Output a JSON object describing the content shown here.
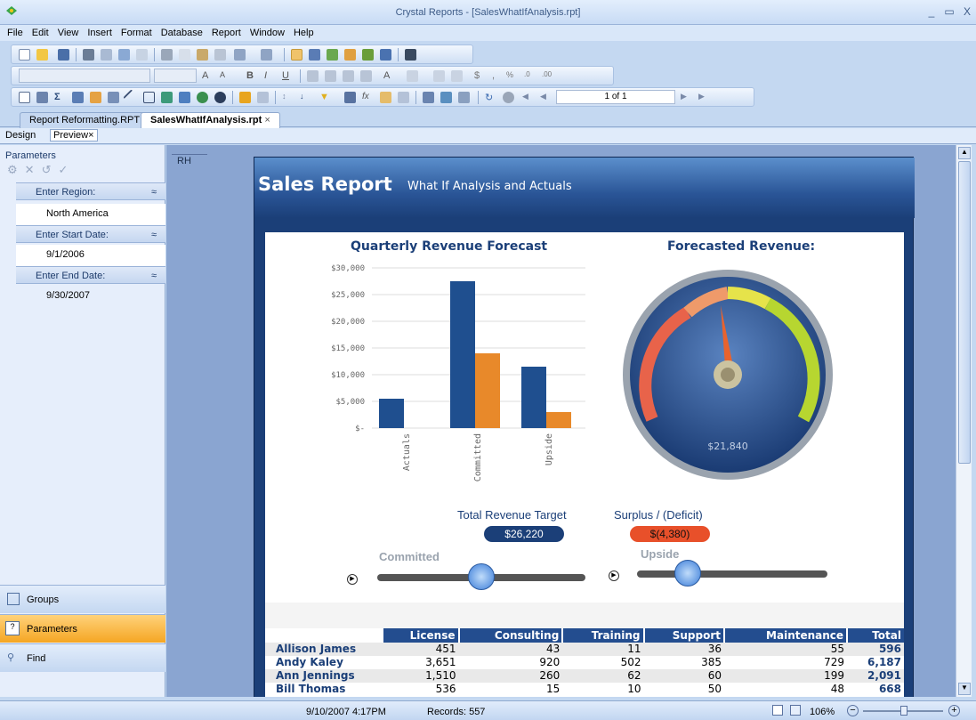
{
  "window": {
    "title": "Crystal Reports - [SalesWhatIfAnalysis.rpt]",
    "min": "_",
    "max": "▭",
    "close": "X"
  },
  "menu": [
    "File",
    "Edit",
    "View",
    "Insert",
    "Format",
    "Database",
    "Report",
    "Window",
    "Help"
  ],
  "toolbar": {
    "page_indicator": "1 of 1"
  },
  "tabs": [
    {
      "label": "Report Reformatting.RPT"
    },
    {
      "label": "SalesWhatIfAnalysis.rpt",
      "close": "×"
    }
  ],
  "view_tabs": {
    "design": "Design",
    "preview": "Preview",
    "close": "×"
  },
  "left": {
    "title": "Parameters",
    "params": [
      {
        "label": "Enter Region:",
        "value": "North America"
      },
      {
        "label": "Enter Start Date:",
        "value": "9/1/2006"
      },
      {
        "label": "Enter End Date:",
        "value": "9/30/2007"
      }
    ],
    "nav": [
      "Groups",
      "Parameters",
      "Find"
    ]
  },
  "report": {
    "section": "RH",
    "title": "Sales Report",
    "subtitle": "What If Analysis and Actuals",
    "chart_title": "Quarterly Revenue Forecast",
    "gauge_title": "Forecasted Revenue:",
    "gauge_value": "$21,840",
    "target_label": "Total Revenue Target",
    "target_value": "$26,220",
    "surplus_label": "Surplus / (Deficit)",
    "surplus_value": "$(4,380)",
    "slider1": "Committed",
    "slider2": "Upside"
  },
  "chart_data": {
    "type": "bar",
    "title": "Quarterly Revenue Forecast",
    "categories": [
      "Actuals",
      "Committed",
      "Upside"
    ],
    "series": [
      {
        "values": [
          5500,
          27500,
          11500
        ],
        "color": "#1f4f8f"
      },
      {
        "values": [
          0,
          14000,
          3000
        ],
        "color": "#e8892a"
      }
    ],
    "yticks": [
      "$30,000",
      "$25,000",
      "$20,000",
      "$15,000",
      "$10,000",
      "$5,000",
      "$-"
    ],
    "ylim": [
      0,
      30000
    ]
  },
  "table": {
    "headers": [
      "License",
      "Consulting",
      "Training",
      "Support",
      "Maintenance",
      "Total"
    ],
    "rows": [
      {
        "name": "Allison James",
        "vals": [
          "451",
          "43",
          "11",
          "36",
          "55",
          "596"
        ]
      },
      {
        "name": "Andy Kaley",
        "vals": [
          "3,651",
          "920",
          "502",
          "385",
          "729",
          "6,187"
        ]
      },
      {
        "name": "Ann Jennings",
        "vals": [
          "1,510",
          "260",
          "62",
          "60",
          "199",
          "2,091"
        ]
      },
      {
        "name": "Bill Thomas",
        "vals": [
          "536",
          "15",
          "10",
          "50",
          "48",
          "668"
        ]
      }
    ]
  },
  "status": {
    "datetime": "9/10/2007  4:17PM",
    "records": "Records: 557",
    "zoom": "106%"
  }
}
